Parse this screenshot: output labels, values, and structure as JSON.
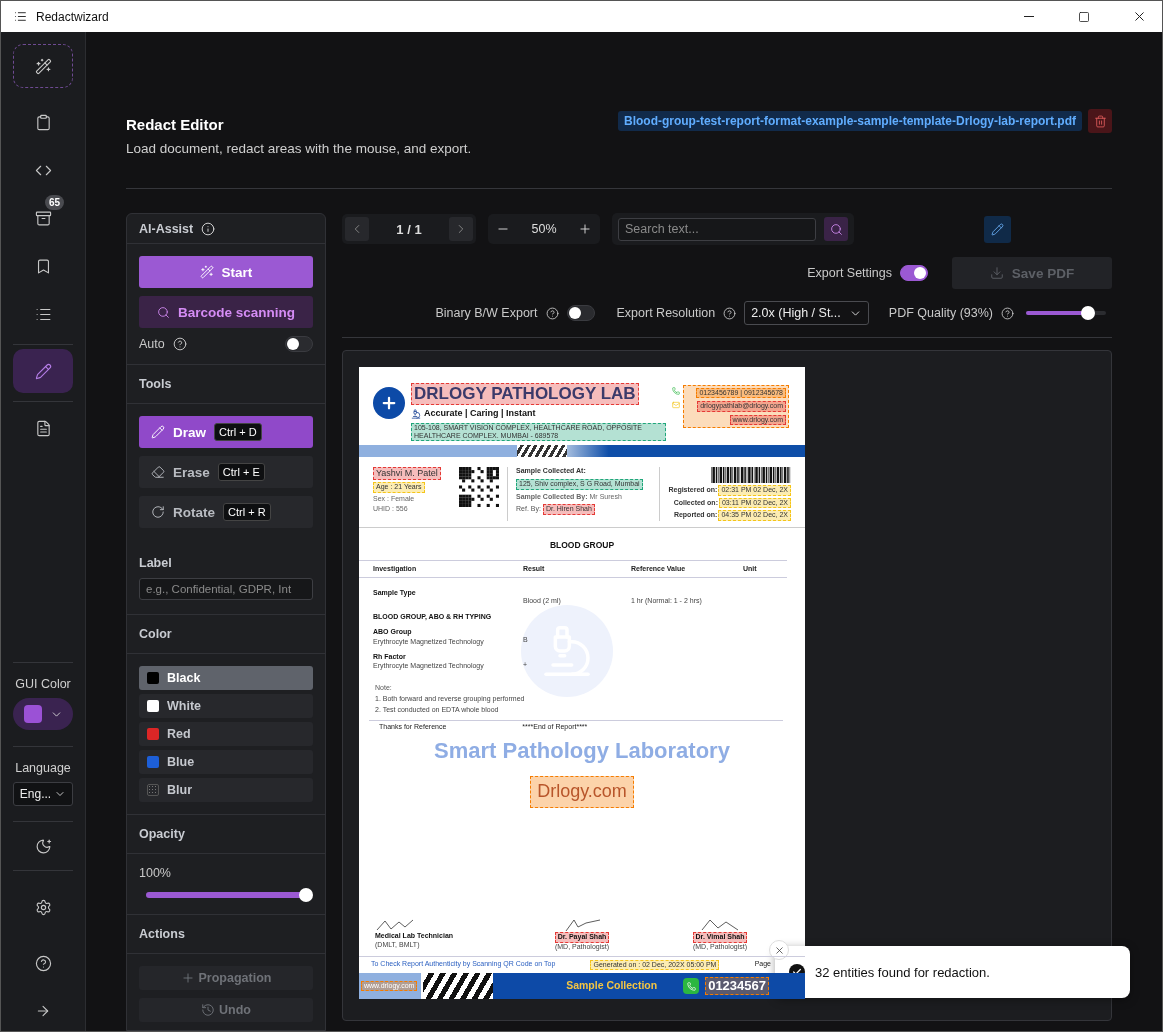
{
  "window": {
    "title": "Redactwizard"
  },
  "rail": {
    "items": [
      {
        "focused": true,
        "selected": false
      },
      {
        "focused": false,
        "selected": false
      },
      {
        "focused": false,
        "selected": false
      },
      {
        "focused": false,
        "selected": false,
        "badge": "65"
      },
      {
        "focused": false,
        "selected": false
      },
      {
        "focused": false,
        "selected": false
      },
      {
        "focused": false,
        "selected": true
      },
      {
        "focused": false,
        "selected": false
      }
    ],
    "gui_color_label": "GUI Color",
    "language_label": "Language",
    "language_value": "Eng..."
  },
  "header": {
    "title": "Redact Editor",
    "subtitle": "Load document, redact areas with the mouse, and export.",
    "file": "Blood-group-test-report-format-example-sample-template-Drlogy-lab-report.pdf"
  },
  "ai_assist": {
    "title": "AI-Assist",
    "start": "Start",
    "barcode": "Barcode scanning",
    "auto": {
      "label": "Auto",
      "on": false
    }
  },
  "tools": {
    "title": "Tools",
    "items": [
      {
        "label": "Draw",
        "shortcut": "Ctrl + D",
        "selected": true
      },
      {
        "label": "Erase",
        "shortcut": "Ctrl + E",
        "selected": false
      },
      {
        "label": "Rotate",
        "shortcut": "Ctrl + R",
        "selected": false
      }
    ]
  },
  "label_field": {
    "title": "Label",
    "placeholder": "e.g., Confidential, GDPR, Int"
  },
  "colors": {
    "title": "Color",
    "options": [
      {
        "kind": "swatch",
        "label": "Black",
        "color": "#000000",
        "selected": true
      },
      {
        "kind": "swatch",
        "label": "White",
        "color": "#ffffff",
        "selected": false
      },
      {
        "kind": "swatch",
        "label": "Red",
        "color": "#dc2626",
        "selected": false
      },
      {
        "kind": "swatch",
        "label": "Blue",
        "color": "#1d5fd8",
        "selected": false
      },
      {
        "kind": "blur",
        "label": "Blur",
        "selected": false
      }
    ]
  },
  "opacity": {
    "title": "Opacity",
    "reading": "100%",
    "level": 1
  },
  "actions": {
    "title": "Actions",
    "buttons": [
      {
        "kind": "add",
        "label": "Propagation",
        "disabled": true
      },
      {
        "kind": "undo",
        "label": "Undo",
        "disabled": true
      }
    ]
  },
  "viewer_toolbar": {
    "page": "1 / 1",
    "zoom": "50%",
    "search_placeholder": "Search text..."
  },
  "export": {
    "settings": {
      "label": "Export Settings",
      "on": true
    },
    "save": {
      "label": "Save PDF",
      "disabled": true
    },
    "binary": {
      "label": "Binary B/W Export",
      "on": false
    },
    "resolution": {
      "label": "Export Resolution",
      "value": "2.0x (High / St..."
    },
    "quality": {
      "label": "PDF Quality (93%)",
      "level": 0.78
    }
  },
  "document": {
    "lab_name": {
      "text": "DRLOGY PATHOLOGY LAB",
      "color": "#e53935"
    },
    "tagline": "Accurate  | Caring  |  Instant",
    "address": {
      "text": "105-108, SMART VISION COMPLEX, HEALTHCARE ROAD, OPPOSITE HEALTHCARE COMPLEX. MUMBAI - 689578",
      "color": "#1fa67a"
    },
    "contact_area": {
      "color": "#f57c00"
    },
    "phone": {
      "text": "0123456789 | 0912345678",
      "color": "#f57c00"
    },
    "email": {
      "text": "drlogypathlab@drlogy.com",
      "color": "#e53935"
    },
    "website": {
      "text": "www.drlogy.com",
      "color": "#e53935"
    },
    "patient": {
      "name": {
        "text": "Yashvi M. Patel",
        "color": "#e53935"
      },
      "age": {
        "text": "Age : 21 Years",
        "color": "#f5c518"
      },
      "sex": "Sex : Female",
      "uhid": "UHID : 556"
    },
    "collection": {
      "title": "Sample Collected At:",
      "address": {
        "text": "125, Shiv complex, S G Road, Mumbai",
        "color": "#1fa67a"
      },
      "collected_by": "**Sample Collected By:** Mr Suresh",
      "ref_label": "Ref. By:",
      "ref": {
        "text": "Dr. Hiren Shah",
        "color": "#e53935"
      }
    },
    "dates": [
      {
        "label": "Registered on:",
        "value": {
          "text": "02:31 PM 02 Dec, 2X",
          "color": "#f5c518"
        }
      },
      {
        "label": "Collected on:",
        "value": {
          "text": "03:11 PM 02 Dec, 2X",
          "color": "#f5c518"
        }
      },
      {
        "label": "Reported on:",
        "value": {
          "text": "04:35 PM 02 Dec, 2X",
          "color": "#f5c518"
        }
      }
    ],
    "test_title": "BLOOD GROUP",
    "columns": [
      "Investigation",
      "Result",
      "Reference Value",
      "Unit"
    ],
    "rows": [
      {
        "name": "Sample Type",
        "result": "Blood (2 ml)",
        "reference": "1 hr (Normal: 1 - 2 hrs)"
      },
      {
        "name": "BLOOD GROUP, ABO & RH TYPING"
      },
      {
        "name": "ABO Group",
        "method": "Erythrocyte Magnetized Technology",
        "result": "B"
      },
      {
        "name": "Rh Factor",
        "method": "Erythrocyte Magnetized Technology",
        "result": "+"
      }
    ],
    "note_title": "Note:",
    "notes": [
      "1. Both forward and reverse grouping performed",
      "2. Test conducted on EDTA whole blood"
    ],
    "thanks": "Thanks for Reference",
    "end": "****End of Report****",
    "watermark": "Smart Pathology Laboratory",
    "stamp": {
      "text": "Drlogy.com",
      "color": "#f57c00"
    },
    "signatures": [
      {
        "name": {
          "text": "Medical Lab Technician"
        },
        "degree": "(DMLT, BMLT)"
      },
      {
        "name": {
          "text": "Dr. Payal Shah",
          "color": "#e53935"
        },
        "degree": "(MD, Pathologist)"
      },
      {
        "name": {
          "text": "Dr. Vimal Shah",
          "color": "#e53935"
        },
        "degree": "(MD, Pathologist)"
      }
    ],
    "qr_note": "To Check Report Authenticity by Scanning QR Code on Top",
    "generated": {
      "text": "Generated on : 02 Dec, 202X 05:00 PM",
      "color": "#f5c518"
    },
    "page": "Page",
    "band_site": {
      "text": "www.drlogy.com",
      "color": "#f57c00"
    },
    "band_label": "Sample Collection",
    "band_phone": {
      "text": "01234567",
      "color": "#f57c00"
    }
  },
  "toast": {
    "message": "32 entities found for redaction."
  }
}
